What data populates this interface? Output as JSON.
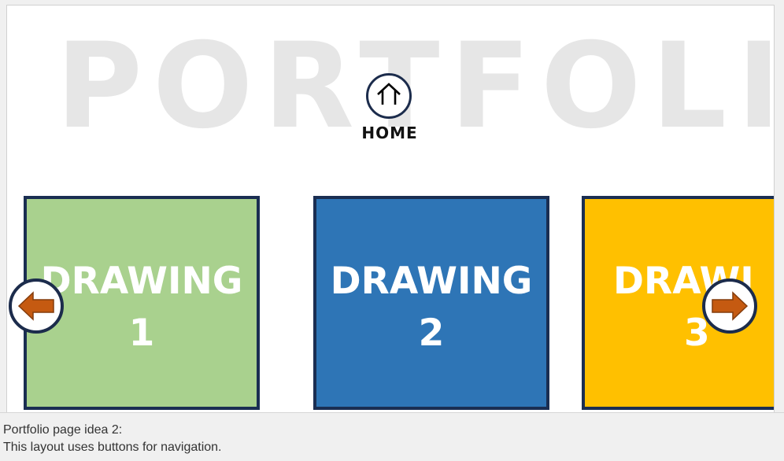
{
  "slide": {
    "watermark": "PORTFOLIO",
    "home": {
      "label": "HOME",
      "icon": "house-icon"
    },
    "tiles": [
      {
        "title": "DRAWING",
        "number": "1",
        "color": "#a9d18e"
      },
      {
        "title": "DRAWING",
        "number": "2",
        "color": "#2e75b6"
      },
      {
        "title": "DRAWI",
        "number": "3",
        "color": "#ffc000"
      }
    ],
    "nav": {
      "prev_icon": "arrow-left-icon",
      "next_icon": "arrow-right-icon",
      "arrow_color": "#c55a11"
    },
    "border_color": "#1a2e52"
  },
  "notes": {
    "line1": "Portfolio page idea 2:",
    "line2": "This layout uses buttons for navigation."
  }
}
